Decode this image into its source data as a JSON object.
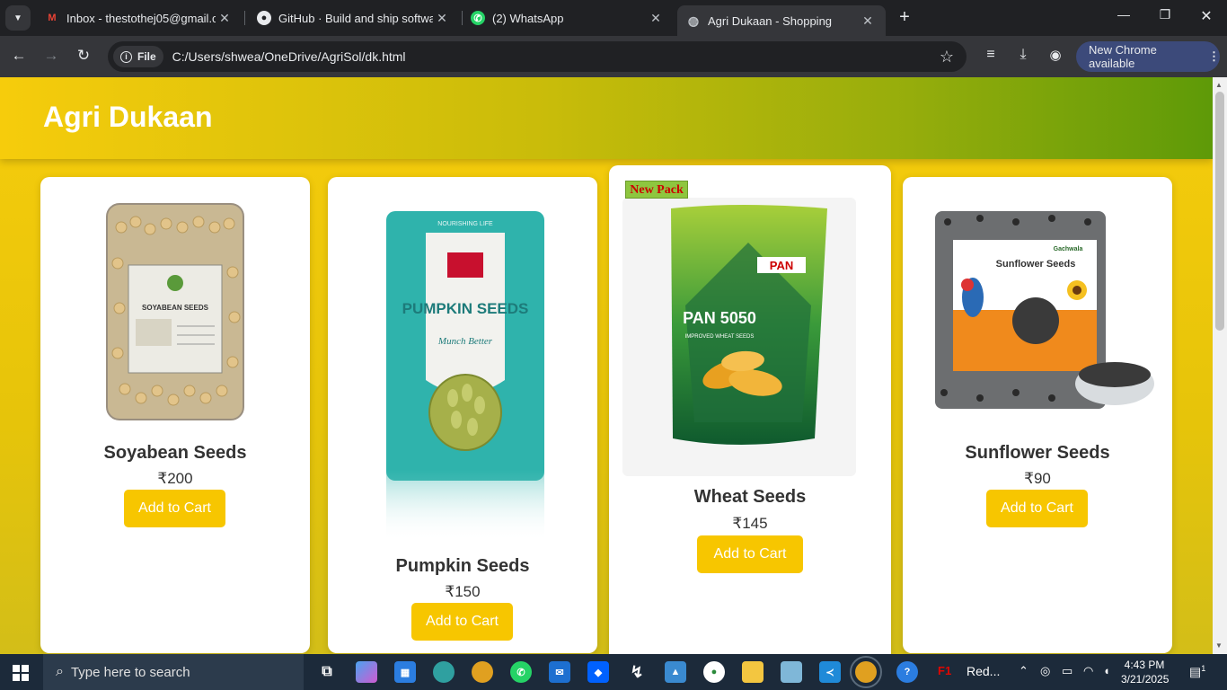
{
  "browser": {
    "tabs": [
      {
        "title": "Inbox - thestothej05@gmail.com",
        "icon": "gmail-icon",
        "active": false
      },
      {
        "title": "GitHub · Build and ship software",
        "icon": "github-icon",
        "active": false
      },
      {
        "title": "(2) WhatsApp",
        "icon": "whatsapp-icon",
        "active": false
      },
      {
        "title": "Agri Dukaan - Shopping",
        "icon": "globe-icon",
        "active": true
      }
    ],
    "scheme_label": "File",
    "url": "C:/Users/shwea/OneDrive/AgriSol/dk.html",
    "update_label": "New Chrome available"
  },
  "page": {
    "brand": "Agri Dukaan",
    "products": [
      {
        "name": "Soyabean Seeds",
        "price": "₹200",
        "button": "Add to Cart",
        "badge": ""
      },
      {
        "name": "Pumpkin Seeds",
        "price": "₹150",
        "button": "Add to Cart",
        "badge": ""
      },
      {
        "name": "Wheat Seeds",
        "price": "₹145",
        "button": "Add to Cart",
        "badge": "New Pack"
      },
      {
        "name": "Sunflower Seeds",
        "price": "₹90",
        "button": "Add to Cart",
        "badge": ""
      }
    ],
    "package_text": {
      "soy": "SOYABEAN SEEDS",
      "pumpkin_top": "NOURISHING LIFE",
      "pumpkin_main": "PUMPKIN SEEDS",
      "pumpkin_sub": "Munch Better",
      "wheat_brand": "PAN",
      "wheat_main": "PAN 5050",
      "wheat_sub": "IMPROVED WHEAT SEEDS",
      "sunflower_brand": "Gachwala",
      "sunflower_main": "Sunflower Seeds"
    }
  },
  "taskbar": {
    "search_placeholder": "Type here to search",
    "pinned_label": "Red...",
    "time": "4:43 PM",
    "date": "3/21/2025",
    "notifications": "1"
  },
  "colors": {
    "accent": "#f7c600",
    "header_start": "#f6cc0c",
    "header_end": "#5e9a08",
    "badge_bg": "#8ec63f",
    "badge_text": "#cc0000"
  }
}
